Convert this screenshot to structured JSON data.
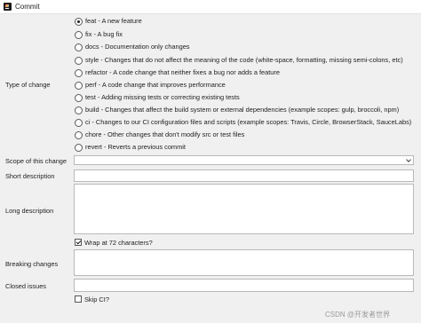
{
  "window": {
    "title": "Commit",
    "app_icon": "intellij-idea-icon"
  },
  "type_of_change": {
    "label": "Type of change",
    "options": [
      {
        "label": "feat - A new feature",
        "checked": true
      },
      {
        "label": "fix - A bug fix",
        "checked": false
      },
      {
        "label": "docs - Documentation only changes",
        "checked": false
      },
      {
        "label": "style - Changes that do not affect the meaning of the code (white-space, formatting, missing semi-colons, etc)",
        "checked": false
      },
      {
        "label": "refactor - A code change that neither fixes a bug nor adds a feature",
        "checked": false
      },
      {
        "label": "perf - A code change that improves performance",
        "checked": false
      },
      {
        "label": "test - Adding missing tests or correcting existing tests",
        "checked": false
      },
      {
        "label": "build - Changes that affect the build system or external dependencies (example scopes: gulp, broccoli, npm)",
        "checked": false
      },
      {
        "label": "ci - Changes to our CI configuration files and scripts (example scopes: Travis, Circle, BrowserStack, SauceLabs)",
        "checked": false
      },
      {
        "label": "chore - Other changes that don't modify src or test files",
        "checked": false
      },
      {
        "label": "revert - Reverts a previous commit",
        "checked": false
      }
    ]
  },
  "scope": {
    "label": "Scope of this change",
    "value": ""
  },
  "short_description": {
    "label": "Short description",
    "value": ""
  },
  "long_description": {
    "label": "Long description",
    "value": ""
  },
  "wrap": {
    "label": "Wrap at 72 characters?",
    "checked": true
  },
  "breaking_changes": {
    "label": "Breaking changes",
    "value": ""
  },
  "closed_issues": {
    "label": "Closed issues",
    "value": ""
  },
  "skip_ci": {
    "label": "Skip CI?",
    "checked": false
  },
  "watermark": "CSDN @开发者世界"
}
